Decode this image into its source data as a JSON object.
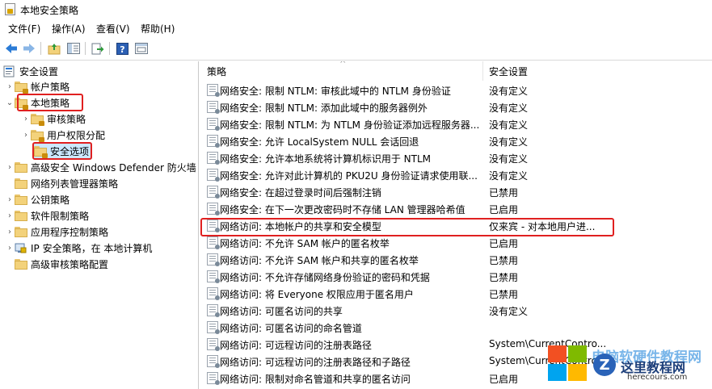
{
  "window": {
    "title": "本地安全策略"
  },
  "menu": [
    {
      "label": "文件(F)"
    },
    {
      "label": "操作(A)"
    },
    {
      "label": "查看(V)"
    },
    {
      "label": "帮助(H)"
    }
  ],
  "toolbar": {
    "buttons": [
      {
        "icon": "back-arrow-icon"
      },
      {
        "icon": "forward-arrow-icon"
      },
      {
        "icon": "up-folder-icon"
      },
      {
        "icon": "show-hide-tree-icon"
      },
      {
        "icon": "export-list-icon"
      },
      {
        "icon": "help-icon"
      },
      {
        "icon": "properties-icon"
      }
    ]
  },
  "tree": {
    "root": "安全设置",
    "items": [
      {
        "label": "帐户策略"
      },
      {
        "label": "本地策略"
      },
      {
        "label": "审核策略"
      },
      {
        "label": "用户权限分配"
      },
      {
        "label": "安全选项"
      },
      {
        "label": "高级安全 Windows Defender 防火墙"
      },
      {
        "label": "网络列表管理器策略"
      },
      {
        "label": "公钥策略"
      },
      {
        "label": "软件限制策略"
      },
      {
        "label": "应用程序控制策略"
      },
      {
        "label": "IP 安全策略，在 本地计算机"
      },
      {
        "label": "高级审核策略配置"
      }
    ]
  },
  "list": {
    "columns": {
      "policy": "策略",
      "setting": "安全设置"
    },
    "rows": [
      {
        "policy": "网络安全: 限制 NTLM: 审核此域中的 NTLM 身份验证",
        "setting": "没有定义"
      },
      {
        "policy": "网络安全: 限制 NTLM: 添加此域中的服务器例外",
        "setting": "没有定义"
      },
      {
        "policy": "网络安全: 限制 NTLM: 为 NTLM 身份验证添加远程服务器...",
        "setting": "没有定义"
      },
      {
        "policy": "网络安全: 允许 LocalSystem NULL 会话回退",
        "setting": "没有定义"
      },
      {
        "policy": "网络安全: 允许本地系统将计算机标识用于 NTLM",
        "setting": "没有定义"
      },
      {
        "policy": "网络安全: 允许对此计算机的 PKU2U 身份验证请求使用联...",
        "setting": "没有定义"
      },
      {
        "policy": "网络安全: 在超过登录时间后强制注销",
        "setting": "已禁用"
      },
      {
        "policy": "网络安全: 在下一次更改密码时不存储 LAN 管理器哈希值",
        "setting": "已启用"
      },
      {
        "policy": "网络访问: 本地帐户的共享和安全模型",
        "setting": "仅来宾 - 对本地用户进..."
      },
      {
        "policy": "网络访问: 不允许 SAM 帐户的匿名枚举",
        "setting": "已启用"
      },
      {
        "policy": "网络访问: 不允许 SAM 帐户和共享的匿名枚举",
        "setting": "已禁用"
      },
      {
        "policy": "网络访问: 不允许存储网络身份验证的密码和凭据",
        "setting": "已禁用"
      },
      {
        "policy": "网络访问: 将 Everyone 权限应用于匿名用户",
        "setting": "已禁用"
      },
      {
        "policy": "网络访问: 可匿名访问的共享",
        "setting": "没有定义"
      },
      {
        "policy": "网络访问: 可匿名访问的命名管道",
        "setting": ""
      },
      {
        "policy": "网络访问: 可远程访问的注册表路径",
        "setting": "System\\CurrentContro..."
      },
      {
        "policy": "网络访问: 可远程访问的注册表路径和子路径",
        "setting": "System\\CurrentContro..."
      },
      {
        "policy": "网络访问: 限制对命名管道和共享的匿名访问",
        "setting": "已启用"
      }
    ]
  },
  "watermark": {
    "title": "电脑软硬件教程网",
    "cn": "这里教程网",
    "en": "herecours.com"
  },
  "colors": {
    "highlight_box": "#e02020",
    "selection": "#cce8ff"
  }
}
